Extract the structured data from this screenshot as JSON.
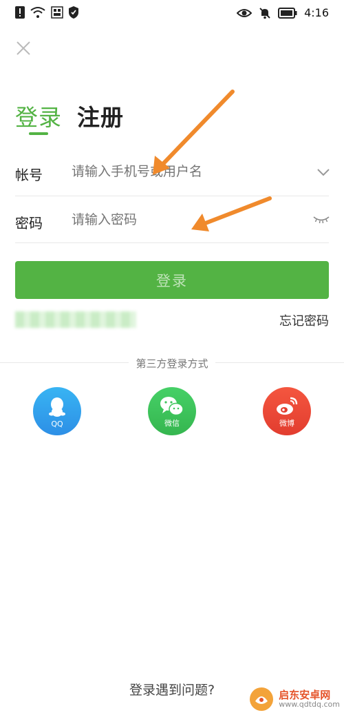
{
  "status_bar": {
    "time": "4:16"
  },
  "tabs": {
    "login": "登录",
    "register": "注册"
  },
  "account": {
    "label": "帐号",
    "placeholder": "请输入手机号或用户名"
  },
  "password": {
    "label": "密码",
    "placeholder": "请输入密码"
  },
  "login_button": "登录",
  "forgot_password": "忘记密码",
  "third_party": {
    "title": "第三方登录方式",
    "items": [
      {
        "label": "QQ",
        "color": "#2ea8ef",
        "icon": "qq-penguin-icon"
      },
      {
        "label": "微信",
        "color": "#3ec55b",
        "icon": "wechat-icon"
      },
      {
        "label": "微博",
        "color": "#f04a3a",
        "icon": "weibo-icon"
      }
    ]
  },
  "help_link": "登录遇到问题?",
  "watermark": {
    "name": "启东安卓网",
    "url": "www.qdtdq.com"
  },
  "colors": {
    "accent": "#53b344",
    "arrow": "#f08a2c"
  }
}
